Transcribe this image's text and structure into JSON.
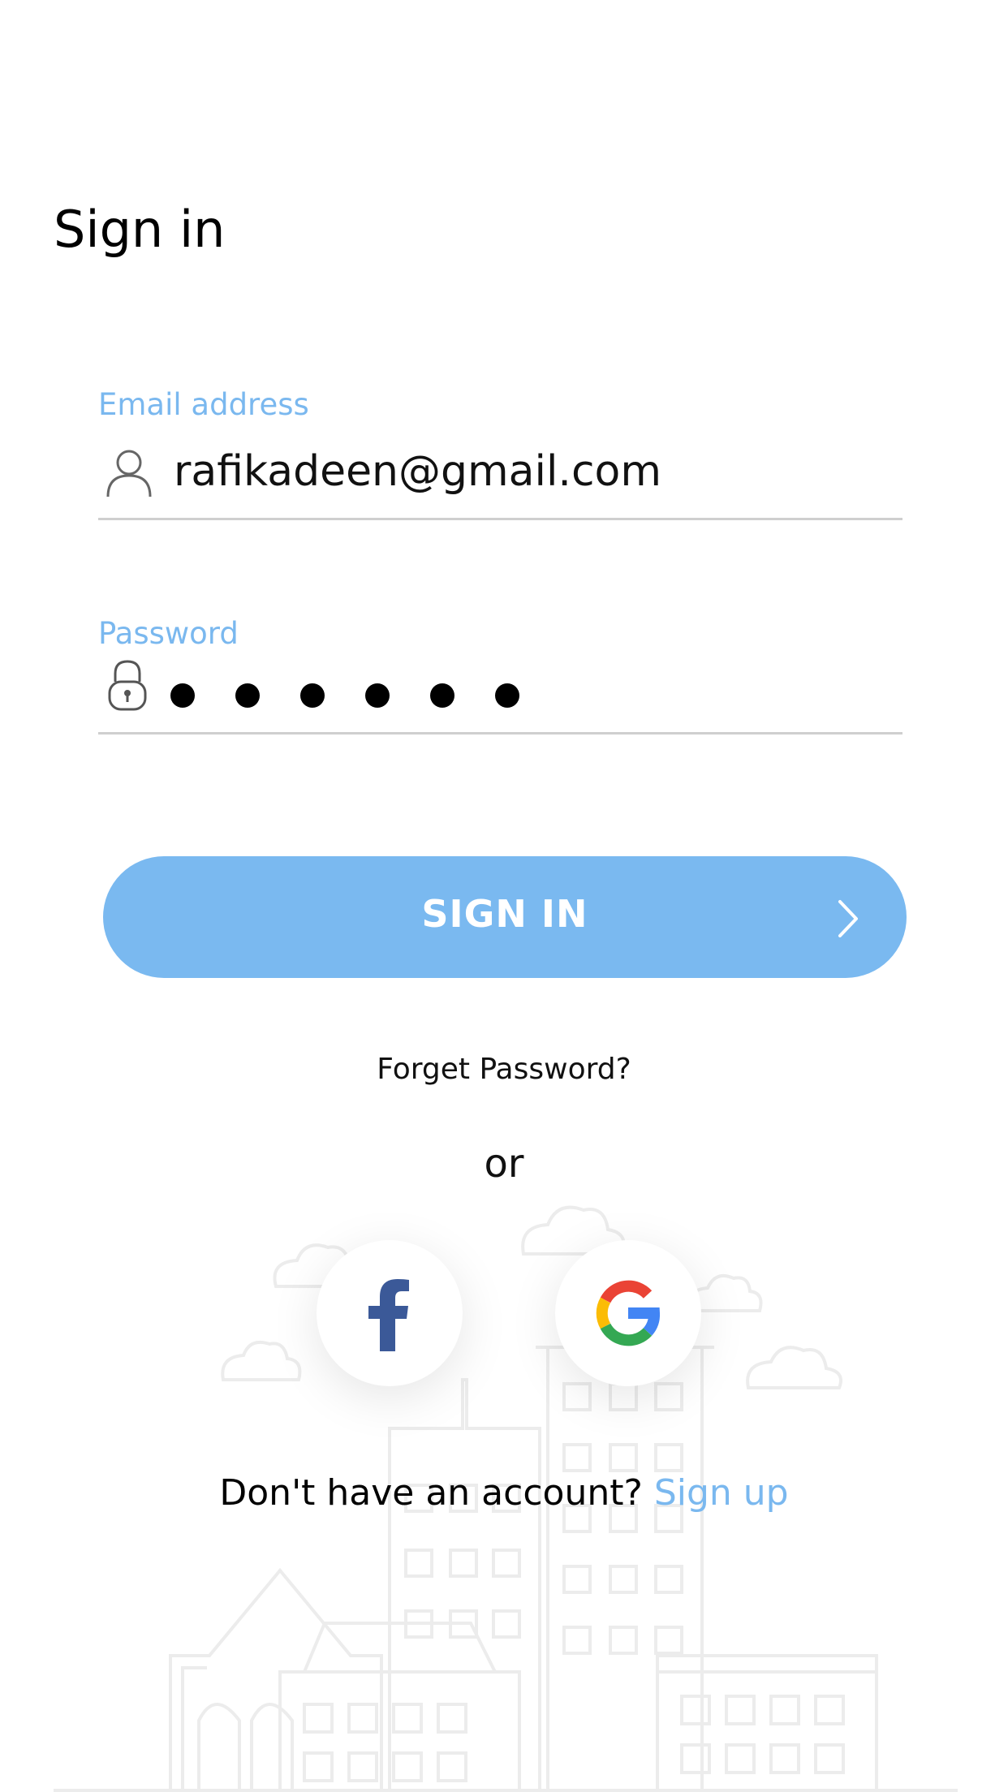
{
  "page": {
    "title": "Sign in"
  },
  "email": {
    "label": "Email address",
    "value": "rafikadeen@gmail.com",
    "icon": "user-icon"
  },
  "password": {
    "label": "Password",
    "masked_length": 6,
    "icon": "lock-icon"
  },
  "signin_button": {
    "label": "SIGN IN",
    "icon": "chevron-right-icon"
  },
  "forgot_password": {
    "label": "Forget Password?"
  },
  "divider": {
    "label": "or"
  },
  "social": {
    "facebook_icon": "facebook-icon",
    "google_icon": "google-icon"
  },
  "signup": {
    "prompt": "Don't have an account?",
    "link_label": "Sign up"
  },
  "colors": {
    "accent": "#7ab9f0",
    "label": "#7ab8ef",
    "underline": "#cfcfcf",
    "facebook": "#3b5998"
  }
}
